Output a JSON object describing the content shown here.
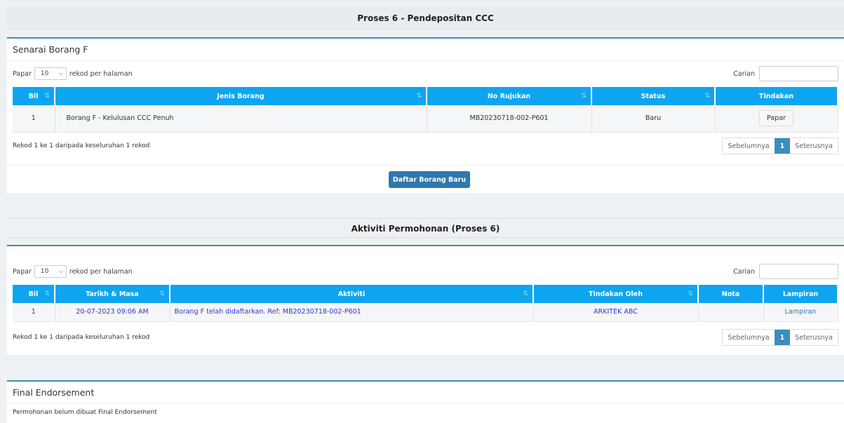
{
  "section1": {
    "title": "Proses 6 - Pendepositan CCC",
    "card_title": "Senarai Borang F",
    "show_label": "Papar",
    "page_size": "10",
    "per_page_label": "rekod per halaman",
    "search_label": "Carian",
    "columns": [
      "Bil",
      "Jenis Borang",
      "No Rujukan",
      "Status",
      "Tindakan"
    ],
    "rows": [
      {
        "bil": "1",
        "jenis": "Borang F - Kelulusan CCC Penuh",
        "rujukan": "MB20230718-002-P601",
        "status": "Baru",
        "action": "Papar"
      }
    ],
    "info": "Rekod 1 ke 1 daripada keseluruhan 1 rekod",
    "pager": {
      "prev": "Sebelumnya",
      "current": "1",
      "next": "Seterusnya"
    },
    "new_button": "Daftar Borang Baru"
  },
  "section2": {
    "title": "Aktiviti Permohonan (Proses 6)",
    "show_label": "Papar",
    "page_size": "10",
    "per_page_label": "rekod per halaman",
    "search_label": "Carian",
    "columns": [
      "Bil",
      "Tarikh & Masa",
      "Aktiviti",
      "Tindakan Oleh",
      "Nota",
      "Lampiran"
    ],
    "rows": [
      {
        "bil": "1",
        "tarikh": "20-07-2023 09:06 AM",
        "aktiviti": "Borang F telah didaftarkan. Ref: MB20230718-002-P601",
        "oleh": "ARKITEK ABC",
        "nota": "",
        "lampiran": "Lampiran"
      }
    ],
    "info": "Rekod 1 ke 1 daripada keseluruhan 1 rekod",
    "pager": {
      "prev": "Sebelumnya",
      "current": "1",
      "next": "Seterusnya"
    }
  },
  "section3": {
    "card_title": "Final Endorsement",
    "message": "Permohonan belum dibuat Final Endorsement"
  },
  "colors": {
    "header_blue": "#0ea5f0",
    "accent": "#3c8dbc",
    "green": "#28a745",
    "button": "#2f78ad"
  }
}
